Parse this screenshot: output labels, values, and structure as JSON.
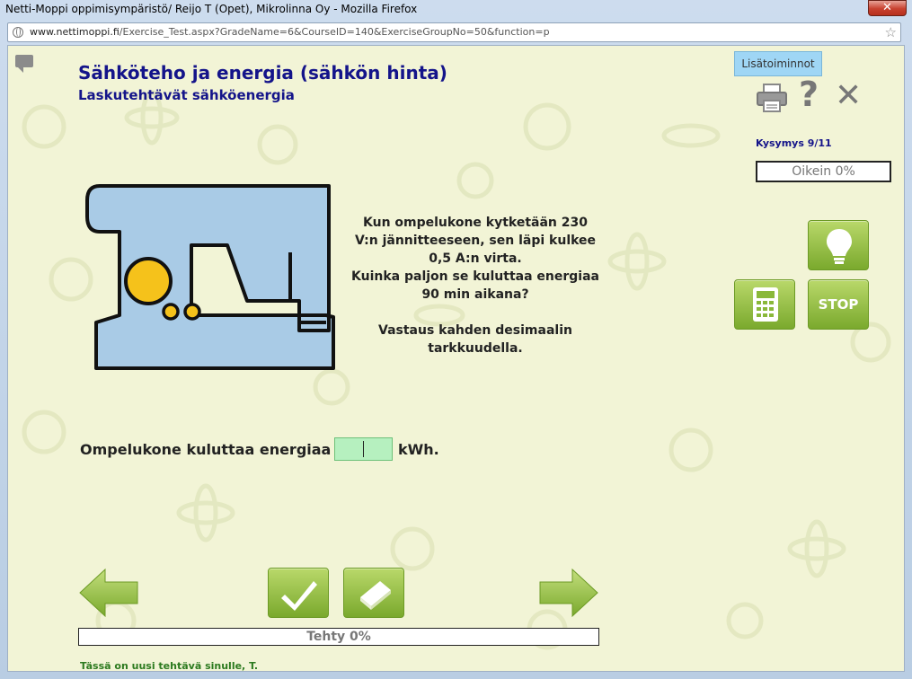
{
  "window": {
    "title": "Netti-Moppi oppimisympäristö/ Reijo T (Opet), Mikrolinna Oy - Mozilla Firefox",
    "close_label": "✕",
    "url_domain": "www.nettimoppi.fi",
    "url_path": "/Exercise_Test.aspx?GradeName=6&CourseID=140&ExerciseGroupNo=50&function=p"
  },
  "header": {
    "title": "Sähköteho ja energia (sähkön hinta)",
    "subtitle": "Laskutehtävät sähköenergia",
    "extra_functions_label": "Lisätoiminnot"
  },
  "sidebar": {
    "question_counter": "Kysymys 9/11",
    "correct_label": "Oikein 0%",
    "stop_label": "STOP"
  },
  "question": {
    "line1": "Kun ompelukone kytketään 230 V:n jännitteeseen, sen läpi kulkee 0,5 A:n virta.",
    "line2": "Kuinka paljon se kuluttaa energiaa 90 min aikana?",
    "line3": "Vastaus kahden desimaalin tarkkuudella."
  },
  "answer": {
    "prompt": "Ompelukone kuluttaa energiaa",
    "value": "",
    "unit": "kWh."
  },
  "footer": {
    "done_label": "Tehty 0%",
    "done_percent": 0,
    "status_message": "Tässä on uusi tehtävä sinulle, T."
  },
  "icons": {
    "hint": "lightbulb-icon",
    "calculator": "calculator-icon",
    "check": "checkmark-icon",
    "eraser": "eraser-icon",
    "prev": "arrow-left-icon",
    "next": "arrow-right-icon",
    "print": "printer-icon",
    "help": "question-icon",
    "close": "close-icon"
  },
  "colors": {
    "title": "#14148a",
    "page_bg": "#f2f4d6",
    "button_green": "#8ab83a",
    "input_bg": "#b6f0bf",
    "status_green": "#2c7a1f"
  }
}
